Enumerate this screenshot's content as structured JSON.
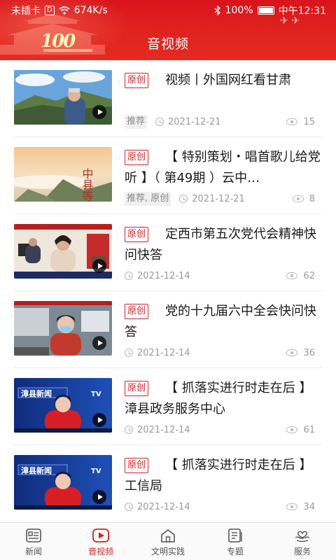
{
  "status_bar": {
    "carrier": "未插卡",
    "speed": "674K/s",
    "battery": "100%",
    "time": "中午12:31"
  },
  "header": {
    "title": "音视频",
    "logo_number": "100"
  },
  "items": [
    {
      "tag": "原创",
      "title": "视频丨外国网红看甘肃",
      "labels": "推荐",
      "date": "2021-12-21",
      "views": "15"
    },
    {
      "tag": "原创",
      "title": "【 特别策划・唱首歌儿给党听 】（ 第49期 ）云中…",
      "labels": "推荐, 原创",
      "date": "2021-12-21",
      "views": "8"
    },
    {
      "tag": "原创",
      "title": "定西市第五次党代会精神快问快答",
      "labels": "",
      "date": "2021-12-14",
      "views": "62"
    },
    {
      "tag": "原创",
      "title": "党的十九届六中全会快问快答",
      "labels": "",
      "date": "2021-12-14",
      "views": "36"
    },
    {
      "tag": "原创",
      "title": "【 抓落实进行时走在后 】漳县政务服务中心",
      "labels": "",
      "date": "2021-12-14",
      "views": "61"
    },
    {
      "tag": "原创",
      "title": "【 抓落实进行时走在后 】工信局",
      "labels": "",
      "date": "2021-12-14",
      "views": "34"
    }
  ],
  "thumb_text": {
    "t2_calligraphy": "中县等你来",
    "t5_channel": "漳县新闻",
    "t5_tv": "TV",
    "t6_channel": "漳县新闻",
    "t6_tv": "TV"
  },
  "tabs": [
    {
      "label": "新闻",
      "icon": "news-icon"
    },
    {
      "label": "音视频",
      "icon": "video-icon"
    },
    {
      "label": "文明实践",
      "icon": "home-icon"
    },
    {
      "label": "专题",
      "icon": "topic-icon"
    },
    {
      "label": "服务",
      "icon": "service-icon"
    }
  ],
  "colors": {
    "brand_red": "#d4232a",
    "header_red": "#e2231f"
  }
}
